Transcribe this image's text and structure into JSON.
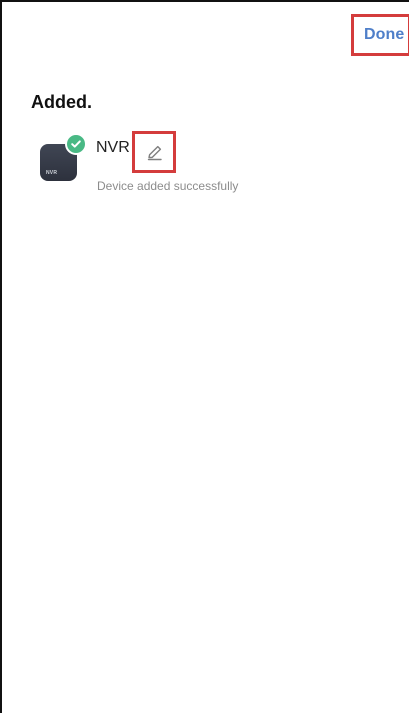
{
  "header": {
    "done_label": "Done"
  },
  "main": {
    "title": "Added.",
    "device": {
      "name": "NVR",
      "thumbnail_label": "NVR",
      "status": "Device added successfully",
      "icons": {
        "status": "check-icon",
        "edit": "pencil-icon"
      }
    }
  },
  "colors": {
    "accent": "#4f7fc9",
    "success": "#49b985",
    "highlight": "#d43c3c"
  }
}
